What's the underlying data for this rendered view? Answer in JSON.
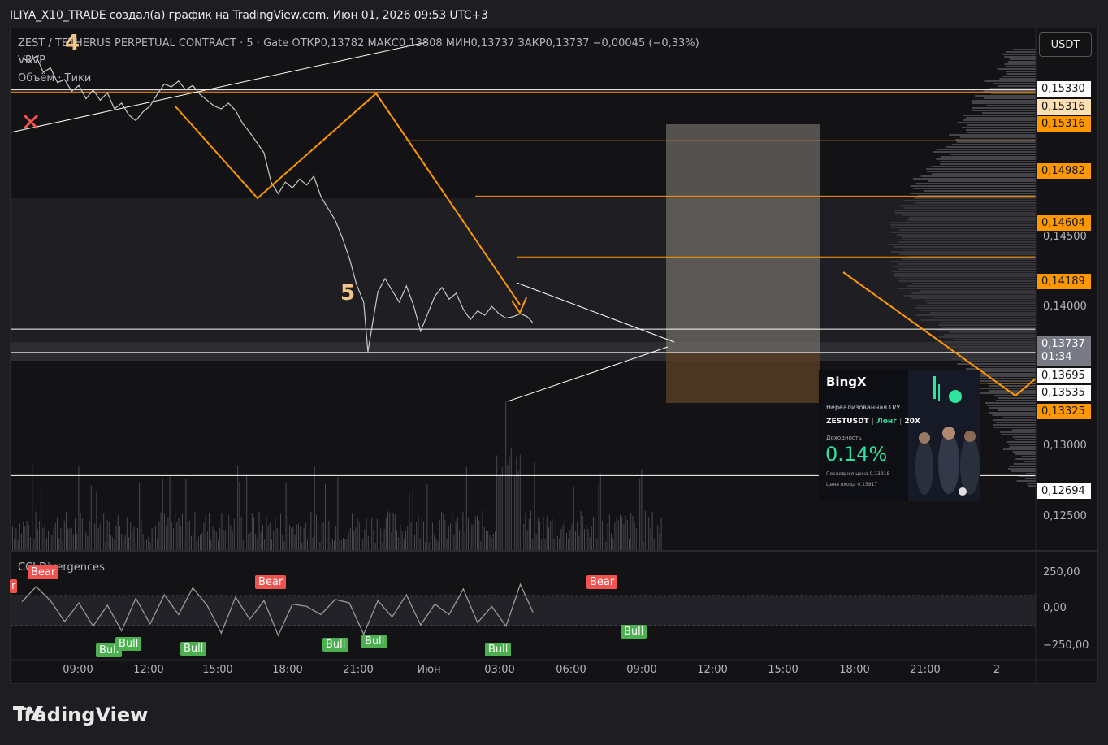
{
  "header": {
    "title": "ILIYA_X10_TRADE создал(а) график на TradingView.com, Июн 01, 2026 09:53 UTC+3"
  },
  "legend": {
    "symbol_line": "ZEST / TETHERUS PERPETUAL CONTRACT · 5 · Gate  ОТКР0,13782  МАКС0,13808  МИН0,13737  ЗАКР0,13737  −0,00045 (−0,33%)",
    "vrvp": "VRVP",
    "volume": "Объём · Тики",
    "cci": "CCI Divergences"
  },
  "toolbar": {
    "currency_button": "USDT"
  },
  "wave_labels": {
    "w4": "4",
    "w5": "5"
  },
  "colors": {
    "background": "#131316",
    "price_line": "#c8c8c8",
    "orange": "#ff9800",
    "white_line": "#ffffff",
    "cci_line": "#9a9a9a",
    "bear": "#f05350",
    "bull": "#4caf50",
    "close_marker": "#f05350"
  },
  "price_axis": {
    "ticks": [
      "0,14500",
      "0,14000",
      "0,13000",
      "0,12500"
    ],
    "tags": [
      {
        "label": "0,15330",
        "style": "white"
      },
      {
        "label": "0,15316",
        "style": "peach"
      },
      {
        "label": "0,15316",
        "style": "orange"
      },
      {
        "label": "0,14982",
        "style": "orange"
      },
      {
        "label": "0,14604",
        "style": "orange"
      },
      {
        "label": "0,14189",
        "style": "orange"
      },
      {
        "label": "0,13695",
        "style": "white"
      },
      {
        "label": "0,13535",
        "style": "white"
      },
      {
        "label": "0,13325",
        "style": "orange"
      },
      {
        "label": "0,12694",
        "style": "white"
      }
    ],
    "current_price": {
      "price": "0,13737",
      "countdown": "01:34"
    }
  },
  "cci_axis": {
    "ticks": [
      "250,00",
      "0,00",
      "−250,00"
    ]
  },
  "time_axis": {
    "labels": [
      "09:00",
      "12:00",
      "15:00",
      "18:00",
      "21:00",
      "Июн",
      "03:00",
      "06:00",
      "09:00",
      "12:00",
      "15:00",
      "18:00",
      "21:00",
      "2"
    ]
  },
  "signals": {
    "bear": [
      "Bear",
      "Bear",
      "Bear"
    ],
    "bull": [
      "Bull",
      "Bull",
      "Bull",
      "Bull",
      "Bull",
      "Bull",
      "Bull"
    ],
    "partial_bear": "r"
  },
  "bingx_card": {
    "brand": "BingX",
    "unrealized": "Нереализованная П/У",
    "pair": "ZESTUSDT",
    "side": "Лонг",
    "leverage": "20X",
    "yield_label": "Доходность",
    "yield_value": "0.14%",
    "last_price": "Последняя цена  0.13918",
    "entry_price": "Цена входа  0.13917"
  },
  "brand": {
    "name": "TradingView"
  },
  "chart_data": {
    "type": "line",
    "title": "ZEST / TETHERUS PERPETUAL CONTRACT · 5 · Gate",
    "ohlc": {
      "open": 0.13782,
      "high": 0.13808,
      "low": 0.13737,
      "close": 0.13737,
      "change": -0.00045,
      "change_pct": -0.33
    },
    "x_unit": "hours since 06:00 (May 31)",
    "price_series": [
      [
        0,
        0.1555
      ],
      [
        0.5,
        0.1552
      ],
      [
        1,
        0.1556
      ],
      [
        1.5,
        0.1545
      ],
      [
        2,
        0.1548
      ],
      [
        2.5,
        0.1538
      ],
      [
        3,
        0.154
      ],
      [
        3.5,
        0.1532
      ],
      [
        4,
        0.1536
      ],
      [
        4.5,
        0.1527
      ],
      [
        5,
        0.1533
      ],
      [
        5.5,
        0.1526
      ],
      [
        6,
        0.1531
      ],
      [
        6.5,
        0.152
      ],
      [
        7,
        0.1524
      ],
      [
        7.5,
        0.1516
      ],
      [
        8,
        0.1512
      ],
      [
        8.5,
        0.1518
      ],
      [
        9,
        0.1522
      ],
      [
        9.5,
        0.153
      ],
      [
        10,
        0.1537
      ],
      [
        10.5,
        0.1535
      ],
      [
        11,
        0.1539
      ],
      [
        11.5,
        0.1533
      ],
      [
        12,
        0.1536
      ],
      [
        12.5,
        0.153
      ],
      [
        13,
        0.1526
      ],
      [
        13.5,
        0.1522
      ],
      [
        14,
        0.152
      ],
      [
        14.5,
        0.1524
      ],
      [
        15,
        0.1519
      ],
      [
        15.5,
        0.151
      ],
      [
        16,
        0.1504
      ],
      [
        16.5,
        0.1497
      ],
      [
        17,
        0.149
      ],
      [
        17.5,
        0.147
      ],
      [
        18,
        0.1462
      ],
      [
        18.5,
        0.147
      ],
      [
        19,
        0.1466
      ],
      [
        19.5,
        0.1472
      ],
      [
        20,
        0.1468
      ],
      [
        20.5,
        0.1474
      ],
      [
        21,
        0.146
      ],
      [
        21.5,
        0.1452
      ],
      [
        22,
        0.1444
      ],
      [
        22.5,
        0.1432
      ],
      [
        23,
        0.1418
      ],
      [
        23.5,
        0.14
      ],
      [
        24,
        0.1388
      ],
      [
        24.3,
        0.1354
      ],
      [
        24.6,
        0.1372
      ],
      [
        25,
        0.1395
      ],
      [
        25.5,
        0.1404
      ],
      [
        26,
        0.1396
      ],
      [
        26.5,
        0.1388
      ],
      [
        27,
        0.1399
      ],
      [
        27.5,
        0.1386
      ],
      [
        28,
        0.1368
      ],
      [
        28.5,
        0.138
      ],
      [
        29,
        0.1392
      ],
      [
        29.5,
        0.1398
      ],
      [
        30,
        0.139
      ],
      [
        30.5,
        0.1394
      ],
      [
        31,
        0.1383
      ],
      [
        31.5,
        0.1376
      ],
      [
        32,
        0.1382
      ],
      [
        32.5,
        0.1379
      ],
      [
        33,
        0.1385
      ],
      [
        33.5,
        0.138
      ],
      [
        34,
        0.1377
      ],
      [
        34.5,
        0.1378
      ],
      [
        35,
        0.138
      ],
      [
        35.5,
        0.1378
      ],
      [
        35.9,
        0.13737
      ]
    ],
    "horizontal_levels": [
      {
        "price": 0.1533,
        "color": "white"
      },
      {
        "price": 0.15316,
        "color": "orange"
      },
      {
        "price": 0.14982,
        "color": "orange"
      },
      {
        "price": 0.14604,
        "color": "orange"
      },
      {
        "price": 0.14189,
        "color": "orange"
      },
      {
        "price": 0.13695,
        "color": "white"
      },
      {
        "price": 0.13535,
        "color": "white"
      },
      {
        "price": 0.13325,
        "color": "orange"
      },
      {
        "price": 0.12694,
        "color": "white"
      }
    ],
    "cci_series": [
      [
        0,
        50
      ],
      [
        1,
        180
      ],
      [
        2,
        60
      ],
      [
        3,
        -120
      ],
      [
        4,
        40
      ],
      [
        5,
        -160
      ],
      [
        6,
        20
      ],
      [
        7,
        -200
      ],
      [
        8,
        80
      ],
      [
        9,
        -140
      ],
      [
        10,
        110
      ],
      [
        11,
        -60
      ],
      [
        12,
        170
      ],
      [
        13,
        20
      ],
      [
        14,
        -220
      ],
      [
        15,
        90
      ],
      [
        16,
        -100
      ],
      [
        17,
        60
      ],
      [
        18,
        -240
      ],
      [
        19,
        30
      ],
      [
        20,
        10
      ],
      [
        21,
        -60
      ],
      [
        22,
        70
      ],
      [
        23,
        40
      ],
      [
        24,
        -230
      ],
      [
        25,
        60
      ],
      [
        26,
        -80
      ],
      [
        27,
        110
      ],
      [
        28,
        -150
      ],
      [
        29,
        30
      ],
      [
        30,
        -60
      ],
      [
        31,
        160
      ],
      [
        32,
        -130
      ],
      [
        33,
        10
      ],
      [
        34,
        -160
      ],
      [
        35,
        200
      ],
      [
        35.9,
        -40
      ]
    ],
    "cci_ylim": [
      -330,
      300
    ],
    "ylim": [
      0.1218,
      0.1575
    ],
    "xlim": [
      0,
      72
    ],
    "grid": false,
    "legend": "top-left"
  }
}
